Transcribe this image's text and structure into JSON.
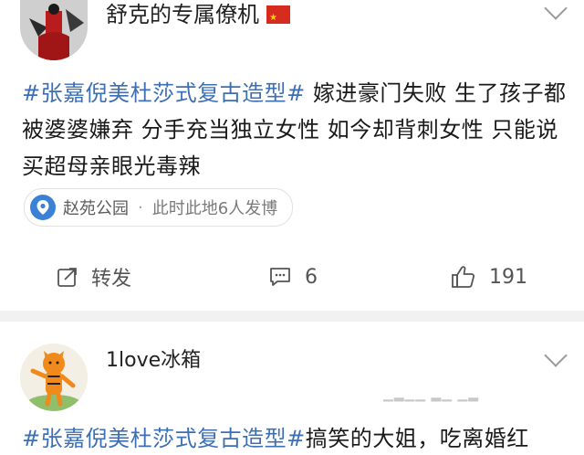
{
  "post1": {
    "username": "舒克的专属僚机",
    "badge_icon": "china-flag-icon",
    "hashtag": "#张嘉倪美杜莎式复古造型#",
    "text": " 嫁进豪门失败 生了孩子都被婆婆嫌弃 分手充当独立女性 如今却背刺女性 只能说买超母亲眼光毒辣",
    "location": {
      "icon": "location-pin-icon",
      "place": "赵苑公园",
      "separator": "·",
      "subtext": "此时此地6人发博"
    },
    "actions": {
      "repost_label": "转发",
      "comment_count": "6",
      "like_count": "191"
    }
  },
  "post2": {
    "username": "1love冰箱",
    "hashtag": "#张嘉倪美杜莎式复古造型#",
    "text": "搞笑的大姐，吃离婚红"
  },
  "colors": {
    "link": "#3d6fb4",
    "location_icon": "#3b82d6",
    "divider": "#f1f1f1"
  }
}
